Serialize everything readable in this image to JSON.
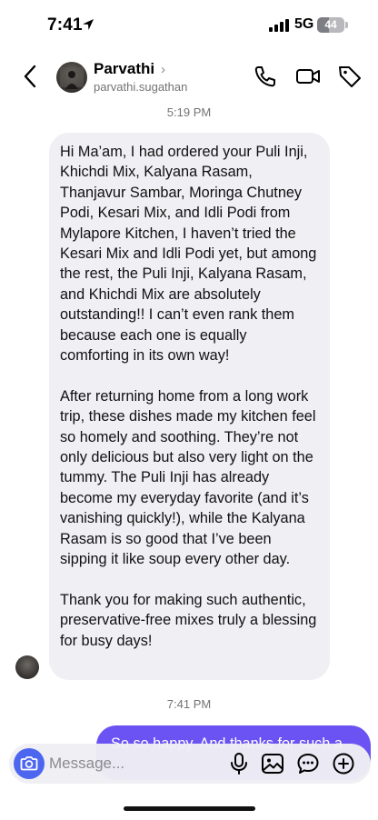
{
  "status_bar": {
    "time": "7:41",
    "network": "5G",
    "battery": "44",
    "battery_level": 0.44
  },
  "header": {
    "contact_name": "Parvathi",
    "handle": "parvathi.sugathan"
  },
  "messages": {
    "timestamp_1": "5:19 PM",
    "incoming": [
      "Hi Ma’am, I had ordered your Puli Inji, Khichdi Mix, Kalyana Rasam, Thanjavur Sambar, Moringa Chutney Podi, Kesari Mix, and Idli Podi from Mylapore Kitchen, I haven’t tried the Kesari Mix and Idli Podi yet, but among the rest, the Puli Inji, Kalyana Rasam, and Khichdi Mix are absolutely outstanding!! I can’t even rank them because each one is equally comforting in its own way!",
      "After returning home from a long work trip, these dishes made my kitchen feel so homely and soothing. They’re not only delicious but also very light on the tummy. The Puli Inji has already become my everyday favorite (and it’s vanishing quickly!), while the Kalyana Rasam is so good that I’ve been sipping it like soup every other day.",
      "Thank you for making such authentic, preservative-free mixes truly a blessing for busy days!"
    ],
    "timestamp_2": "7:41 PM",
    "outgoing": "So so happy. And thanks for such a"
  },
  "composer": {
    "placeholder": "Message..."
  },
  "colors": {
    "accent": "#6b52f2",
    "camera": "#4d66f0",
    "bubble_in": "#efeff4"
  },
  "icons": [
    "back-chevron-icon",
    "phone-icon",
    "video-call-icon",
    "tag-icon",
    "camera-icon",
    "microphone-icon",
    "gallery-icon",
    "sticker-icon",
    "plus-icon"
  ]
}
